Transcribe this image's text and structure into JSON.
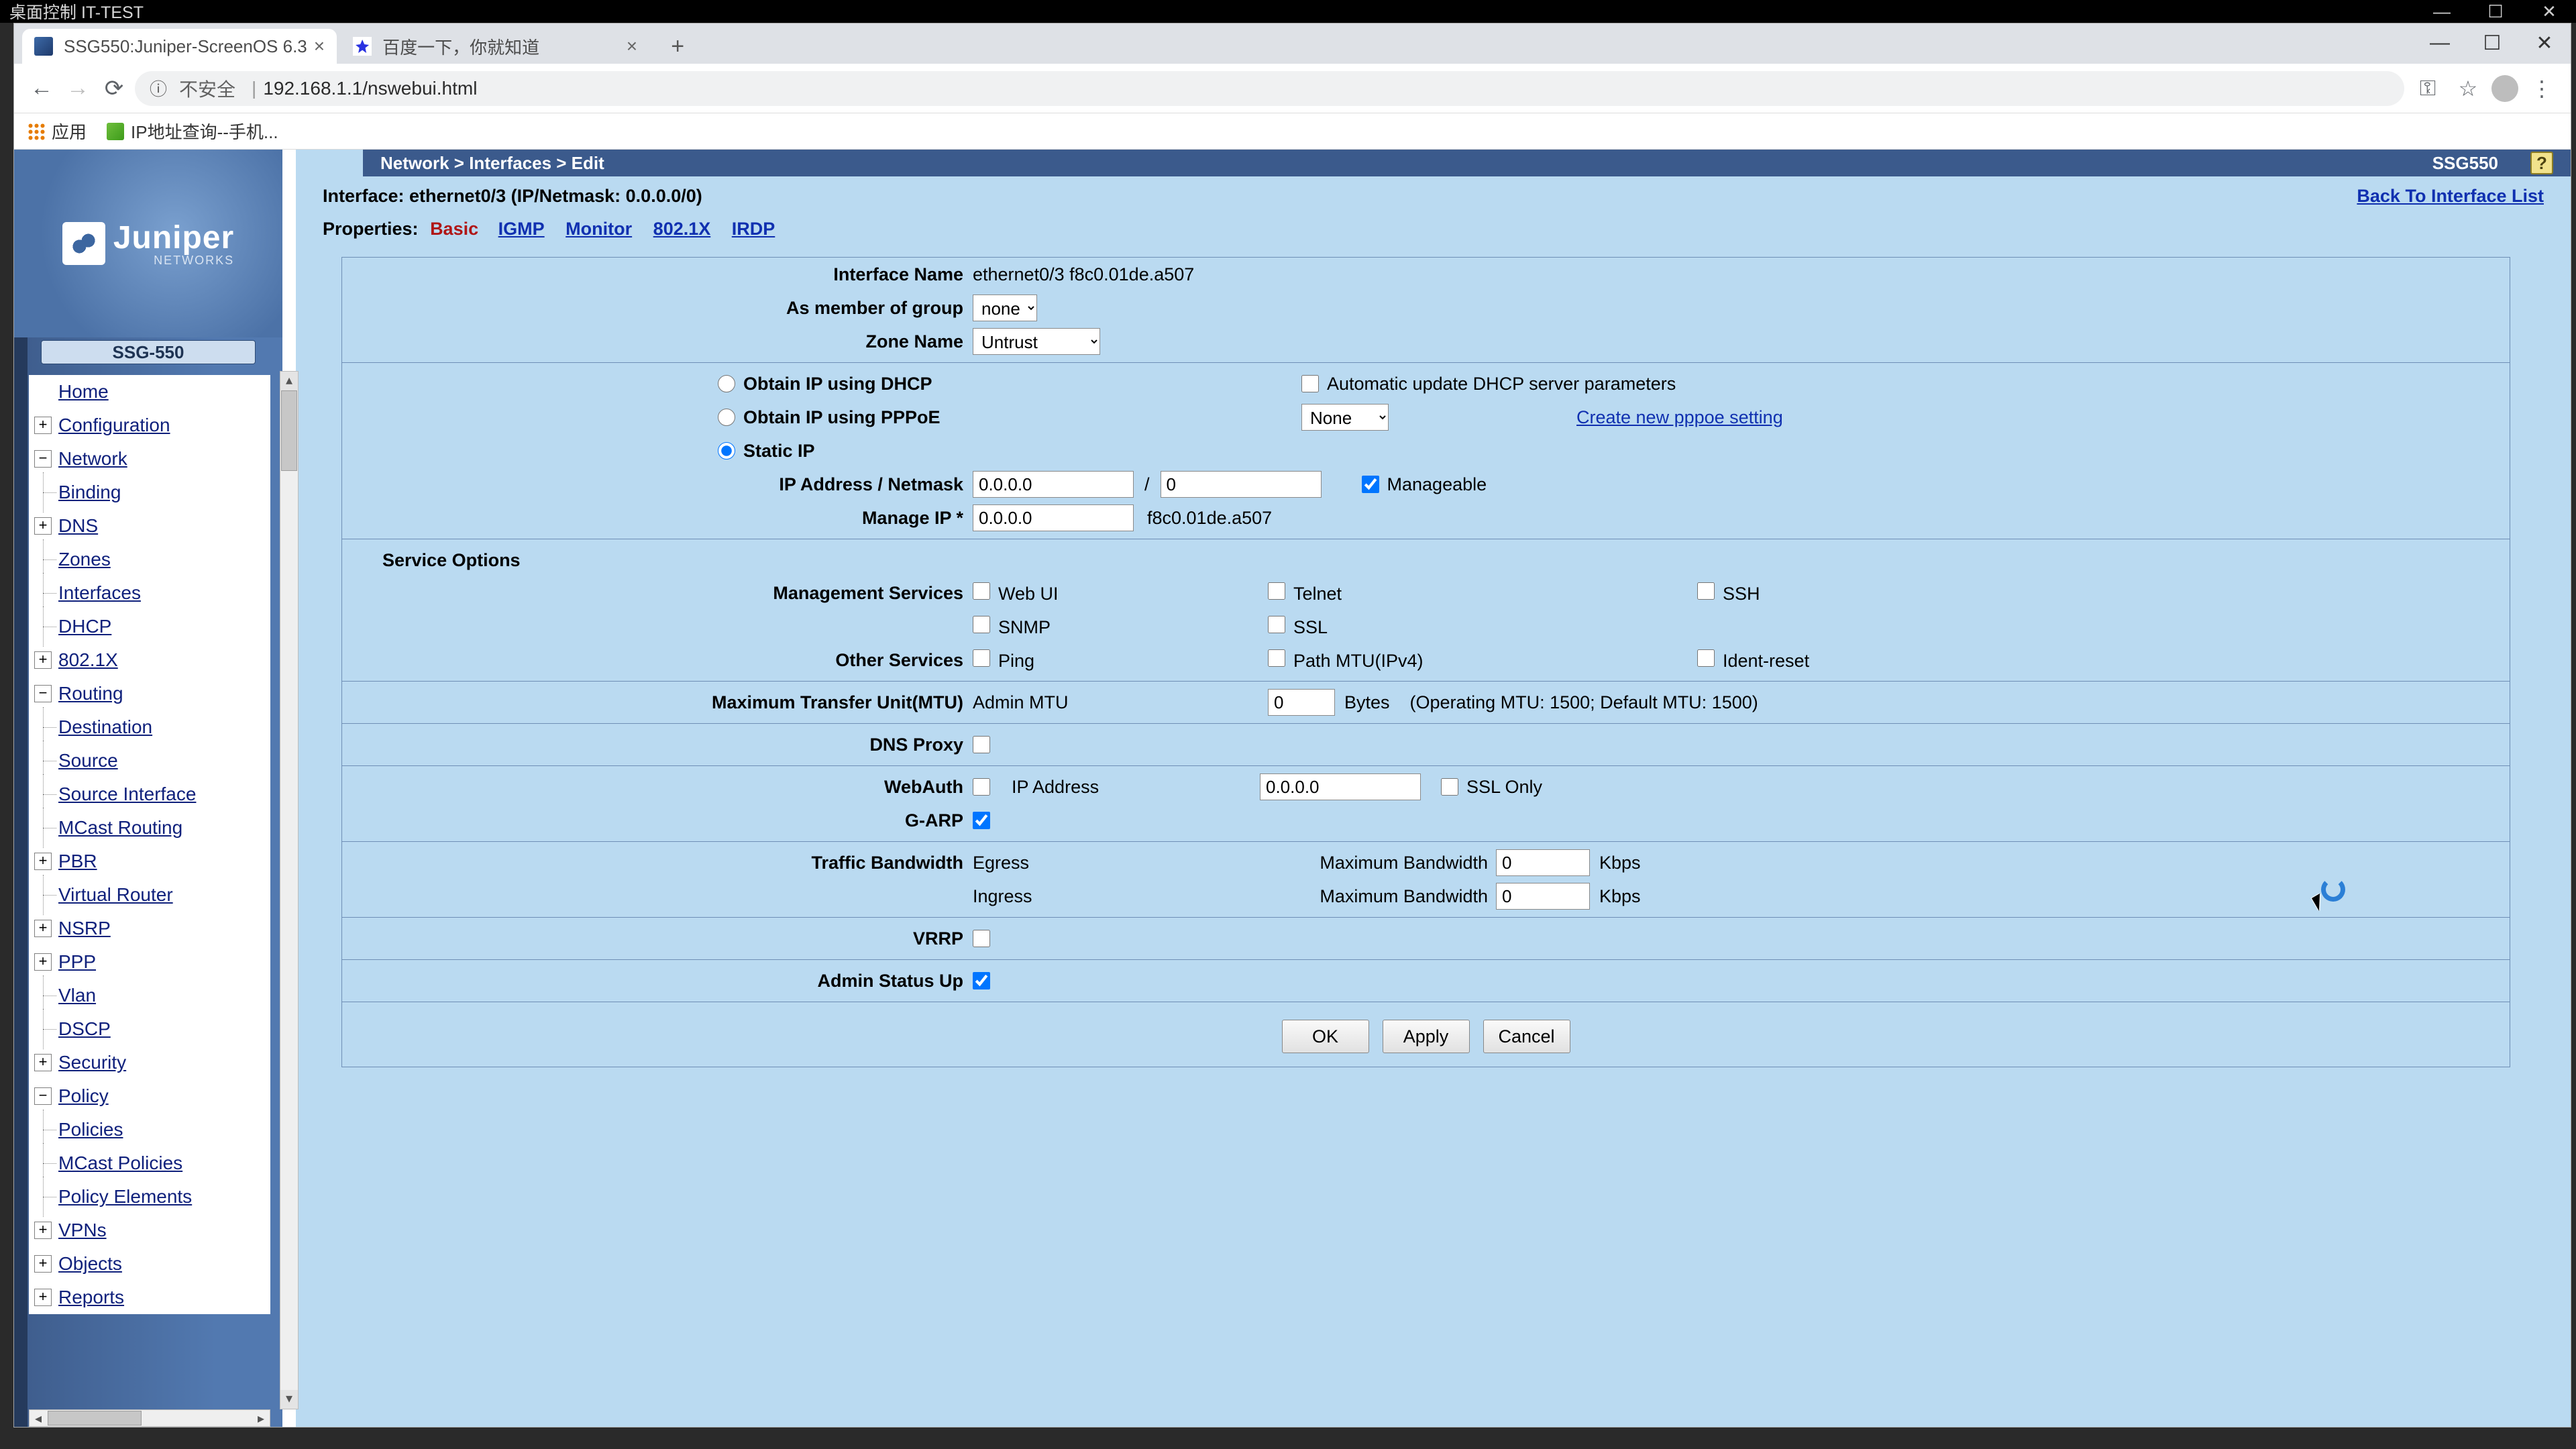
{
  "os_title": "桌面控制 IT-TEST",
  "tabs": [
    {
      "title": "SSG550:Juniper-ScreenOS 6.3"
    },
    {
      "title": "百度一下，你就知道"
    }
  ],
  "omnibox": {
    "warn": "不安全",
    "url": "192.168.1.1/nswebui.html"
  },
  "bookmarks": {
    "apps": "应用",
    "bm1": "IP地址查询--手机..."
  },
  "header": {
    "breadcrumb": "Network > Interfaces > Edit",
    "device": "SSG550",
    "help": "?"
  },
  "sidebar": {
    "model": "SSG-550",
    "items": {
      "home": "Home",
      "config": "Configuration",
      "network": "Network",
      "binding": "Binding",
      "dns": "DNS",
      "zones": "Zones",
      "interfaces": "Interfaces",
      "dhcp": "DHCP",
      "dot1x": "802.1X",
      "routing": "Routing",
      "dest": "Destination",
      "source": "Source",
      "srcif": "Source Interface",
      "mcast": "MCast Routing",
      "pbr": "PBR",
      "vrouter": "Virtual Router",
      "nsrp": "NSRP",
      "ppp": "PPP",
      "vlan": "Vlan",
      "dscp": "DSCP",
      "security": "Security",
      "policy": "Policy",
      "policies": "Policies",
      "mcastpol": "MCast Policies",
      "polel": "Policy Elements",
      "vpns": "VPNs",
      "objects": "Objects",
      "reports": "Reports"
    }
  },
  "main": {
    "iface_title": "Interface: ethernet0/3 (IP/Netmask: 0.0.0.0/0)",
    "back": "Back To Interface List",
    "props_label": "Properties:",
    "props": {
      "basic": "Basic",
      "igmp": "IGMP",
      "monitor": "Monitor",
      "dot1x": "802.1X",
      "irdp": "IRDP"
    },
    "ifname_label": "Interface Name",
    "ifname_val": "ethernet0/3 f8c0.01de.a507",
    "group_label": "As member of group",
    "group_val": "none",
    "zone_label": "Zone Name",
    "zone_val": "Untrust",
    "ip_dhcp": "Obtain IP using DHCP",
    "auto_dhcp": "Automatic update DHCP server parameters",
    "ip_pppoe": "Obtain IP using PPPoE",
    "pppoe_sel": "None",
    "pppoe_link": "Create new pppoe setting",
    "ip_static": "Static IP",
    "ipnm_label": "IP Address / Netmask",
    "ipnm_ip": "0.0.0.0",
    "ipnm_mask": "0",
    "slash": "/",
    "manageable": "Manageable",
    "mng_label": "Manage IP *",
    "mng_ip": "0.0.0.0",
    "mng_mac": "f8c0.01de.a507",
    "svc_h": "Service Options",
    "mgmt_label": "Management Services",
    "webui": "Web UI",
    "telnet": "Telnet",
    "ssh": "SSH",
    "snmp": "SNMP",
    "ssl": "SSL",
    "other_label": "Other Services",
    "ping": "Ping",
    "pathmtu": "Path MTU(IPv4)",
    "ident": "Ident-reset",
    "mtu_label": "Maximum Transfer Unit(MTU)",
    "mtu_admin": "Admin MTU",
    "mtu_val": "0",
    "mtu_bytes": "Bytes",
    "mtu_note": "(Operating MTU: 1500; Default MTU: 1500)",
    "dnsproxy": "DNS Proxy",
    "webauth": "WebAuth",
    "webauth_ip_label": "IP Address",
    "webauth_ip": "0.0.0.0",
    "sslonly": "SSL Only",
    "garp": "G-ARP",
    "tb_label": "Traffic Bandwidth",
    "egress": "Egress",
    "ingress": "Ingress",
    "maxbw": "Maximum Bandwidth",
    "bw_eg": "0",
    "bw_in": "0",
    "kbps": "Kbps",
    "vrrp": "VRRP",
    "adminup": "Admin Status Up",
    "btn_ok": "OK",
    "btn_apply": "Apply",
    "btn_cancel": "Cancel"
  }
}
